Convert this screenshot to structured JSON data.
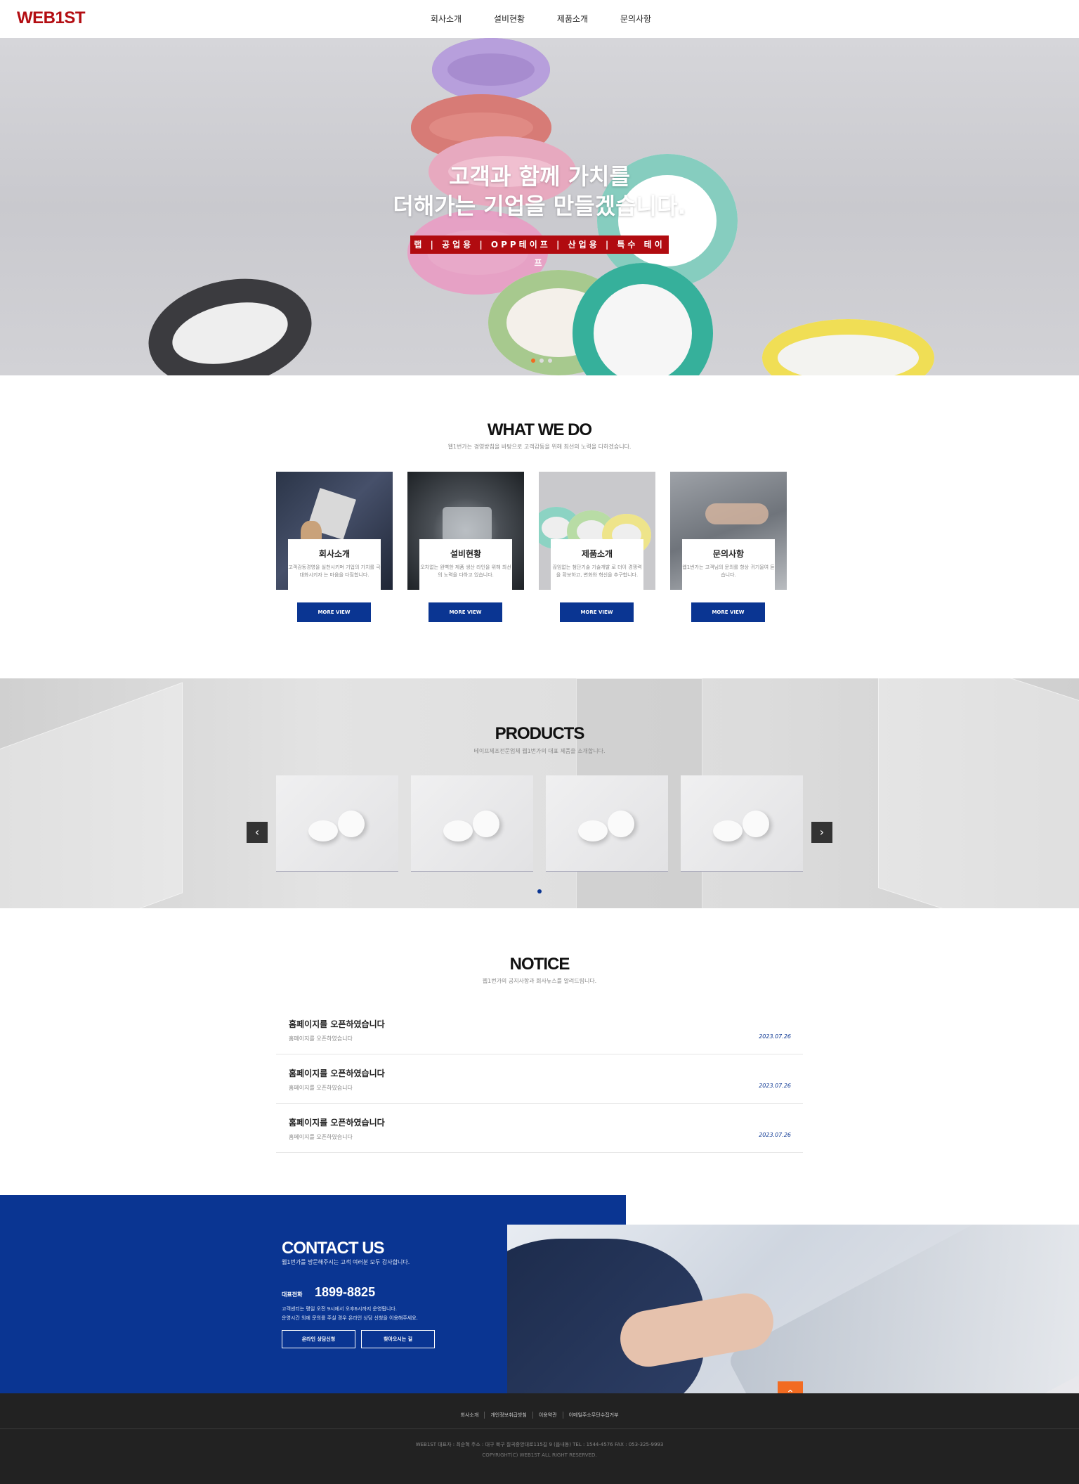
{
  "header": {
    "logo": "WEB1ST",
    "nav": [
      "회사소개",
      "설비현황",
      "제품소개",
      "문의사항"
    ]
  },
  "hero": {
    "title_line1": "고객과 함께 가치를",
    "title_line2": "더해가는 기업을 만들겠습니다.",
    "badge": "랩 | 공업용 | OPP테이프 | 산업용 | 특수 테이프",
    "slide_count": 3,
    "active_slide": 1
  },
  "what_we_do": {
    "title": "WHAT WE DO",
    "subtitle": "웹1번가는 경영방침을 바탕으로 고객감동을 위해 최선의 노력을 다하겠습니다.",
    "cards": [
      {
        "title": "회사소개",
        "desc": "고객감동경영을 실천시키며 기업의 가치를 극대화시키자 는 마음을 다짐합니다.",
        "button": "MORE VIEW"
      },
      {
        "title": "설비현황",
        "desc": "오차없는 완벽한 제품 생산 라인을 위해 최선의 노력을 다하고 있습니다.",
        "button": "MORE VIEW"
      },
      {
        "title": "제품소개",
        "desc": "끊임없는 첨단기술 기술개발 로 더이 경쟁력을 확보하고, 변화와 혁신을 추구합니다.",
        "button": "MORE VIEW"
      },
      {
        "title": "문의사항",
        "desc": "웹1번가는 고객님의 문의를 항상 귀기울여 듣습니다.",
        "button": "MORE VIEW"
      }
    ]
  },
  "products": {
    "title": "PRODUCTS",
    "subtitle": "테이프제조전문업체 웹1번가의 대표 제품을 소개합니다.",
    "prev_icon": "chevron-left-icon",
    "next_icon": "chevron-right-icon",
    "item_count": 4
  },
  "notice": {
    "title": "NOTICE",
    "subtitle": "웹1번가의 공지사항과 회사뉴스를 알려드립니다.",
    "items": [
      {
        "title": "홈페이지를 오픈하였습니다",
        "summary": "홈페이지를 오픈하였습니다",
        "date": "2023.07.26"
      },
      {
        "title": "홈페이지를 오픈하였습니다",
        "summary": "홈페이지를 오픈하였습니다",
        "date": "2023.07.26"
      },
      {
        "title": "홈페이지를 오픈하였습니다",
        "summary": "홈페이지를 오픈하였습니다",
        "date": "2023.07.26"
      }
    ]
  },
  "contact": {
    "title": "CONTACT US",
    "subtitle": "웹1번가를 방문해주시는 고객 여러분 모두 감사합니다.",
    "tel_label": "대표전화",
    "tel": "1899-8825",
    "desc_line1": "고객센터는 평일 오전 9시에서 오후6시까지 운영됩니다.",
    "desc_line2": "운영시간 외에 문의를 주실 경우 온라인 상담 신청을 이용해주세요.",
    "btn_consult": "온라인 상담신청",
    "btn_map": "찾아오시는 길",
    "top_icon": "arrow-up-icon"
  },
  "footer": {
    "links": [
      "회사소개",
      "개인정보취급방침",
      "이용약관",
      "이메일주소무단수집거부"
    ],
    "info": "WEB1ST    대표자 : 최순혁    주소 : 대구 북구 칠곡중앙대로115길 9 (읍내동)    TEL : 1544-4576    FAX : 053-325-9993",
    "copyright": "COPYRIGHT(C) WEB1ST ALL RIGHT RESERVED."
  },
  "colors": {
    "brand_red": "#b30d12",
    "brand_blue": "#0a3592",
    "accent_orange": "#f26b21"
  }
}
